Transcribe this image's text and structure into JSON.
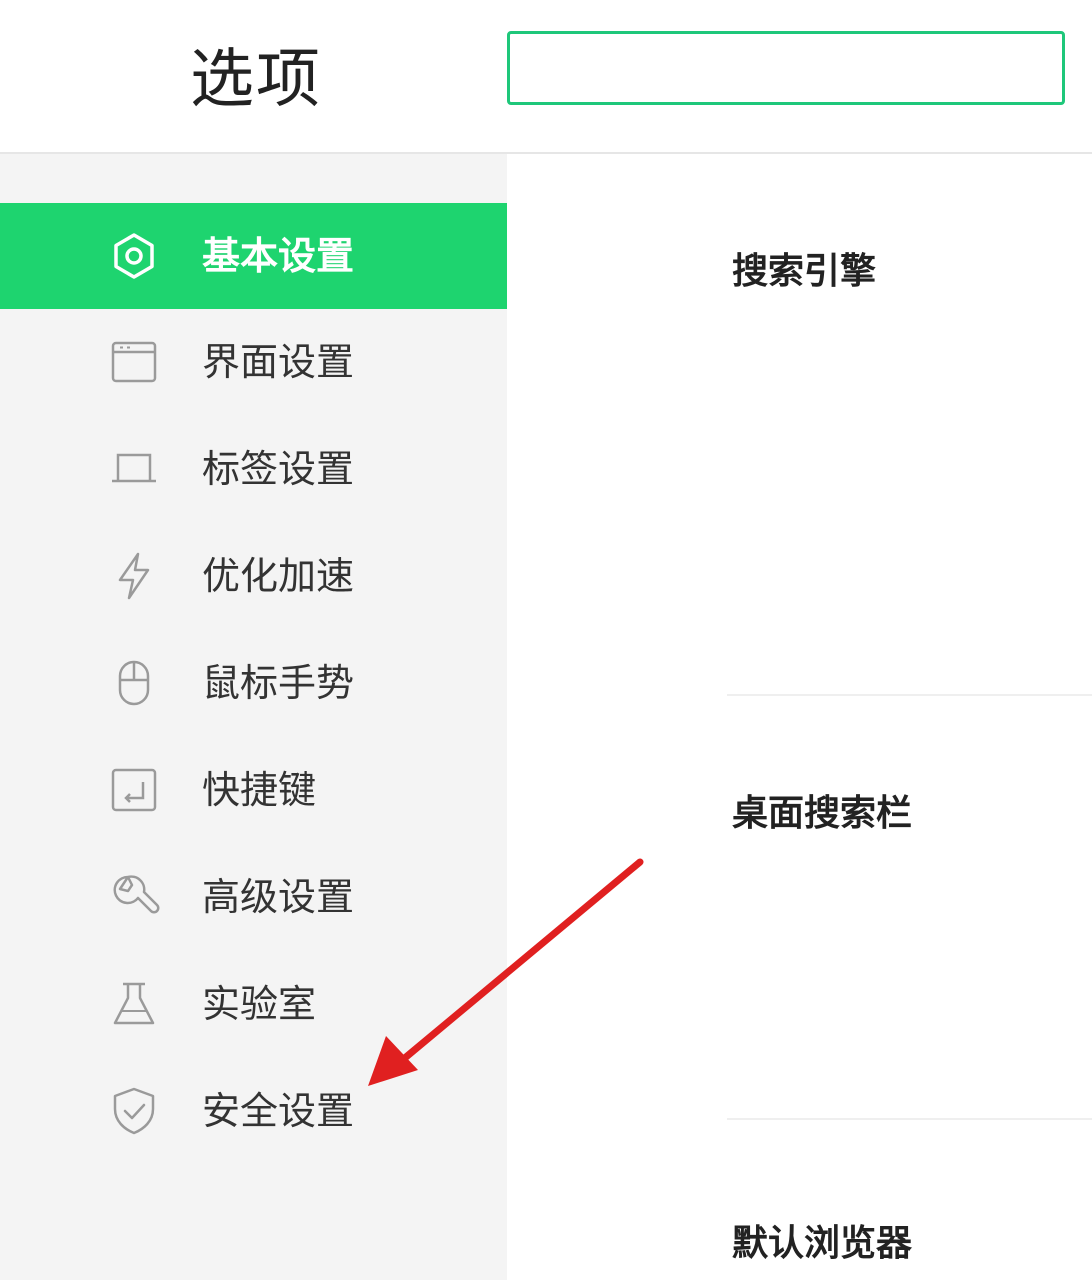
{
  "header": {
    "title": "选项",
    "search": {
      "value": "",
      "placeholder": ""
    }
  },
  "sidebar": {
    "items": [
      {
        "label": "基本设置",
        "icon": "hexagon-gear-icon",
        "active": true
      },
      {
        "label": "界面设置",
        "icon": "window-icon",
        "active": false
      },
      {
        "label": "标签设置",
        "icon": "tab-icon",
        "active": false
      },
      {
        "label": "优化加速",
        "icon": "lightning-icon",
        "active": false
      },
      {
        "label": "鼠标手势",
        "icon": "mouse-icon",
        "active": false
      },
      {
        "label": "快捷键",
        "icon": "shortcut-key-icon",
        "active": false
      },
      {
        "label": "高级设置",
        "icon": "wrench-icon",
        "active": false
      },
      {
        "label": "实验室",
        "icon": "flask-icon",
        "active": false
      },
      {
        "label": "安全设置",
        "icon": "shield-check-icon",
        "active": false
      }
    ]
  },
  "main": {
    "sections": [
      {
        "title": "搜索引擎"
      },
      {
        "title": "桌面搜索栏"
      },
      {
        "title": "默认浏览器"
      }
    ]
  },
  "colors": {
    "accent": "#1ed46f",
    "sidebar_bg": "#f4f4f4",
    "search_border": "#1ec77a",
    "annotation_arrow": "#e02020",
    "icon_stroke": "#9a9a9a"
  }
}
